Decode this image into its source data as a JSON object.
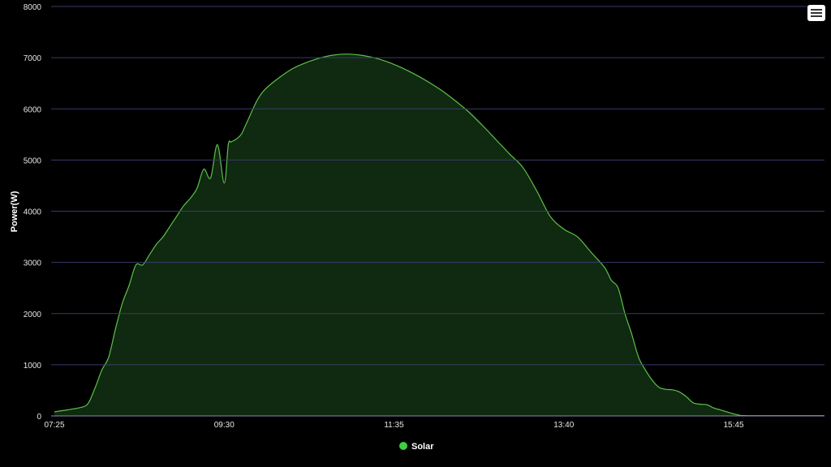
{
  "chart_data": {
    "type": "area",
    "ylabel": "Power(W)",
    "ylim": [
      0,
      8000
    ],
    "y_ticks": [
      0,
      1000,
      2000,
      3000,
      4000,
      5000,
      6000,
      7000,
      8000
    ],
    "x_ticks": [
      "07:25",
      "09:30",
      "11:35",
      "13:40",
      "15:45"
    ],
    "xlim": [
      "07:25",
      "17:10"
    ],
    "grid": true,
    "legend_position": "bottom-center",
    "colors": {
      "series_line": "#5ec04a",
      "series_fill": "#0f2a10",
      "legend_marker": "#3fcf3f",
      "grid": "#3a3a6a"
    },
    "series": [
      {
        "name": "Solar",
        "x": [
          "07:25",
          "07:35",
          "07:45",
          "07:50",
          "07:55",
          "08:00",
          "08:05",
          "08:10",
          "08:15",
          "08:20",
          "08:25",
          "08:30",
          "08:35",
          "08:40",
          "08:45",
          "08:50",
          "08:55",
          "09:00",
          "09:05",
          "09:10",
          "09:15",
          "09:20",
          "09:25",
          "09:30",
          "09:33",
          "09:35",
          "09:37",
          "09:40",
          "09:43",
          "09:45",
          "09:47",
          "09:49",
          "09:51",
          "09:55",
          "10:00",
          "10:10",
          "10:20",
          "10:30",
          "10:40",
          "10:50",
          "11:00",
          "11:10",
          "11:20",
          "11:30",
          "11:40",
          "11:50",
          "12:00",
          "12:10",
          "12:20",
          "12:30",
          "12:40",
          "12:50",
          "13:00",
          "13:10",
          "13:20",
          "13:30",
          "13:40",
          "13:50",
          "14:00",
          "14:10",
          "14:15",
          "14:20",
          "14:25",
          "14:30",
          "14:35",
          "14:40",
          "14:45",
          "14:50",
          "14:55",
          "15:00",
          "15:05",
          "15:10",
          "15:15",
          "15:20",
          "15:25",
          "15:30",
          "15:35",
          "15:40",
          "15:45",
          "15:50",
          "15:55",
          "16:00",
          "16:05",
          "16:10",
          "16:15",
          "16:20",
          "16:25",
          "16:30",
          "16:35",
          "16:40",
          "16:45",
          "16:50",
          "16:55",
          "17:00",
          "17:05",
          "17:10"
        ],
        "values": [
          80,
          120,
          170,
          250,
          550,
          900,
          1150,
          1700,
          2200,
          2550,
          2950,
          2950,
          3150,
          3350,
          3500,
          3700,
          3900,
          4100,
          4250,
          4450,
          4820,
          4650,
          5300,
          4550,
          5300,
          5350,
          5380,
          5430,
          5520,
          5640,
          5750,
          5870,
          5990,
          6200,
          6380,
          6600,
          6780,
          6900,
          6990,
          7050,
          7070,
          7050,
          7000,
          6920,
          6810,
          6680,
          6530,
          6360,
          6160,
          5940,
          5680,
          5400,
          5120,
          4850,
          4400,
          3900,
          3650,
          3500,
          3200,
          2900,
          2650,
          2500,
          2000,
          1600,
          1150,
          900,
          700,
          560,
          520,
          510,
          470,
          380,
          260,
          230,
          220,
          160,
          120,
          80,
          40,
          10,
          5,
          5,
          5,
          5,
          5,
          5,
          5,
          5,
          5,
          5,
          5,
          5,
          5,
          5,
          5,
          5
        ]
      }
    ]
  },
  "menu": {
    "icon": "hamburger-menu-icon"
  }
}
